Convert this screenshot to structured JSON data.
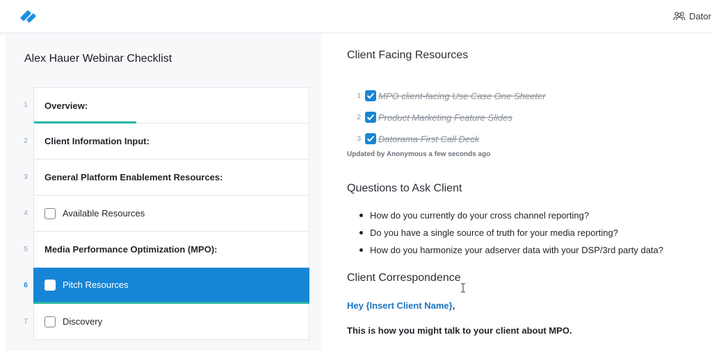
{
  "header": {
    "team_label": "Dator",
    "logo_icon": "process-street-logo-icon",
    "team_icon": "users-icon"
  },
  "sidebar": {
    "title": "Alex Hauer Webinar Checklist",
    "items": [
      {
        "num": "1",
        "label": "Overview:",
        "type": "heading",
        "active": true
      },
      {
        "num": "2",
        "label": "Client Information Input:",
        "type": "heading"
      },
      {
        "num": "3",
        "label": "General Platform Enablement Resources:",
        "type": "heading"
      },
      {
        "num": "4",
        "label": "Available Resources",
        "type": "task"
      },
      {
        "num": "5",
        "label": "Media Performance Optimization (MPO):",
        "type": "heading"
      },
      {
        "num": "6",
        "label": "Pitch Resources",
        "type": "task",
        "selected": true
      },
      {
        "num": "7",
        "label": "Discovery",
        "type": "task"
      }
    ]
  },
  "content": {
    "client_facing": {
      "title": "Client Facing Resources",
      "items": [
        {
          "num": "1",
          "label": "MPO client-facing Use Case One Sheeter",
          "checked": true
        },
        {
          "num": "2",
          "label": "Product Marketing Feature Slides",
          "checked": true
        },
        {
          "num": "3",
          "label": "Datorama First Call Deck",
          "checked": true
        }
      ],
      "updated_text": "Updated by Anonymous a few seconds ago"
    },
    "questions": {
      "title": "Questions to Ask Client",
      "items": [
        "How do you currently do your cross channel reporting?",
        "Do you have a single source of truth for your media reporting?",
        "How do you harmonize your adserver data with your DSP/3rd party data?"
      ]
    },
    "correspondence": {
      "title": "Client Correspondence",
      "greeting": "Hey {Insert Client Name}",
      "greeting_suffix": ",",
      "body": "This is how you might talk to your client about MPO."
    }
  },
  "colors": {
    "accent_blue": "#1785d6",
    "accent_teal": "#27b5a4",
    "link_blue": "#1a73c2"
  }
}
